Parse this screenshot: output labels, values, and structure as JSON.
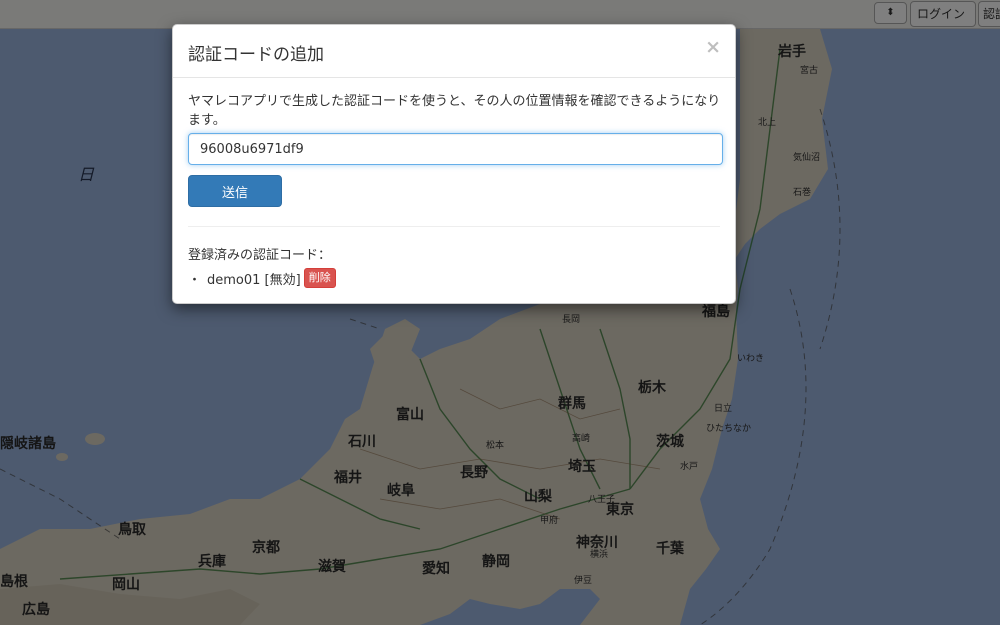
{
  "navbar": {
    "select_value": "",
    "login_label": "ログイン",
    "auth_label": "認証"
  },
  "map": {
    "labels": {
      "iwate": "岩手",
      "miyako": "宮古",
      "kita": "北上",
      "kesennuma": "気仙沼",
      "ishinomaki": "石巻",
      "nihonkai": "日",
      "oki": "隠岐諸島",
      "fukushima": "福島",
      "iwaki": "いわき",
      "tochigi": "栃木",
      "gunma": "群馬",
      "ibaraki": "茨城",
      "hitachi": "日立",
      "hitachinaka": "ひたちなか",
      "toyama": "富山",
      "ishikawa": "石川",
      "fukui": "福井",
      "gifu": "岐阜",
      "nagano": "長野",
      "saitama": "埼玉",
      "yamanashi": "山梨",
      "tokyo": "東京",
      "chiba": "千葉",
      "kanagawa": "神奈川",
      "shizuoka": "静岡",
      "aichi": "愛知",
      "shiga": "滋賀",
      "kyoto": "京都",
      "hyogo": "兵庫",
      "tottori": "鳥取",
      "okayama": "岡山",
      "shimane": "島根",
      "hiroshima": "広島",
      "nagaoka": "長岡",
      "matsumoto": "松本",
      "kofu": "甲府",
      "takasaki": "高崎",
      "mito": "水戸",
      "hachioji": "八王子",
      "yokohama": "横浜",
      "izu": "伊豆"
    }
  },
  "modal": {
    "title": "認証コードの追加",
    "close_glyph": "×",
    "description": "ヤマレコアプリで生成した認証コードを使うと、その人の位置情報を確認できるようになります。",
    "code_value": "96008u6971df9",
    "submit_label": "送信",
    "registered_label": "登録済みの認証コード：",
    "registered_codes": [
      {
        "bullet": "・",
        "text": "demo01 [無効]",
        "delete_label": "削除"
      }
    ]
  },
  "colors": {
    "primary": "#337ab7",
    "danger": "#d9534f",
    "sea": "#9bb4de",
    "land": "#d9d2c2"
  }
}
